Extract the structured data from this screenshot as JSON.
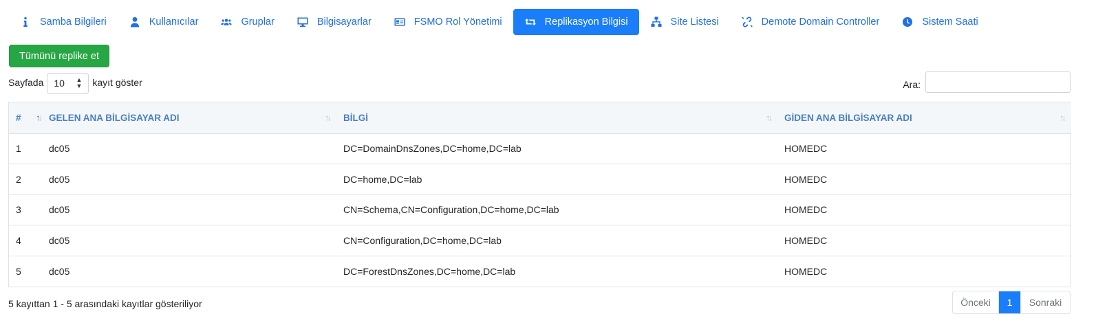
{
  "tabs": [
    {
      "label": "Samba Bilgileri",
      "icon": "info-icon",
      "active": false
    },
    {
      "label": "Kullanıcılar",
      "icon": "user-icon",
      "active": false
    },
    {
      "label": "Gruplar",
      "icon": "users-group-icon",
      "active": false
    },
    {
      "label": "Bilgisayarlar",
      "icon": "desktop-icon",
      "active": false
    },
    {
      "label": "FSMO Rol Yönetimi",
      "icon": "id-card-icon",
      "active": false
    },
    {
      "label": "Replikasyon Bilgisi",
      "icon": "retweet-icon",
      "active": true
    },
    {
      "label": "Site Listesi",
      "icon": "sitemap-icon",
      "active": false
    },
    {
      "label": "Demote Domain Controller",
      "icon": "unlink-icon",
      "active": false
    },
    {
      "label": "Sistem Saati",
      "icon": "clock-icon",
      "active": false
    }
  ],
  "replicate_button": "Tümünü replike et",
  "length": {
    "prefix": "Sayfada",
    "value": "10",
    "suffix": "kayıt göster"
  },
  "search": {
    "label": "Ara:",
    "value": ""
  },
  "table": {
    "columns": [
      "#",
      "GELEN ANA BİLGİSAYAR ADI",
      "BİLGİ",
      "GİDEN ANA BİLGİSAYAR ADI"
    ],
    "rows": [
      [
        "1",
        "dc05",
        "DC=DomainDnsZones,DC=home,DC=lab",
        "HOMEDC"
      ],
      [
        "2",
        "dc05",
        "DC=home,DC=lab",
        "HOMEDC"
      ],
      [
        "3",
        "dc05",
        "CN=Schema,CN=Configuration,DC=home,DC=lab",
        "HOMEDC"
      ],
      [
        "4",
        "dc05",
        "CN=Configuration,DC=home,DC=lab",
        "HOMEDC"
      ],
      [
        "5",
        "dc05",
        "DC=ForestDnsZones,DC=home,DC=lab",
        "HOMEDC"
      ]
    ]
  },
  "info": "5 kayıttan 1 - 5 arasındaki kayıtlar gösteriliyor",
  "pagination": {
    "prev": "Önceki",
    "current": "1",
    "next": "Sonraki"
  },
  "colors": {
    "accent": "#1a7efb",
    "success": "#27a744",
    "header_text": "#4a7fc1"
  }
}
